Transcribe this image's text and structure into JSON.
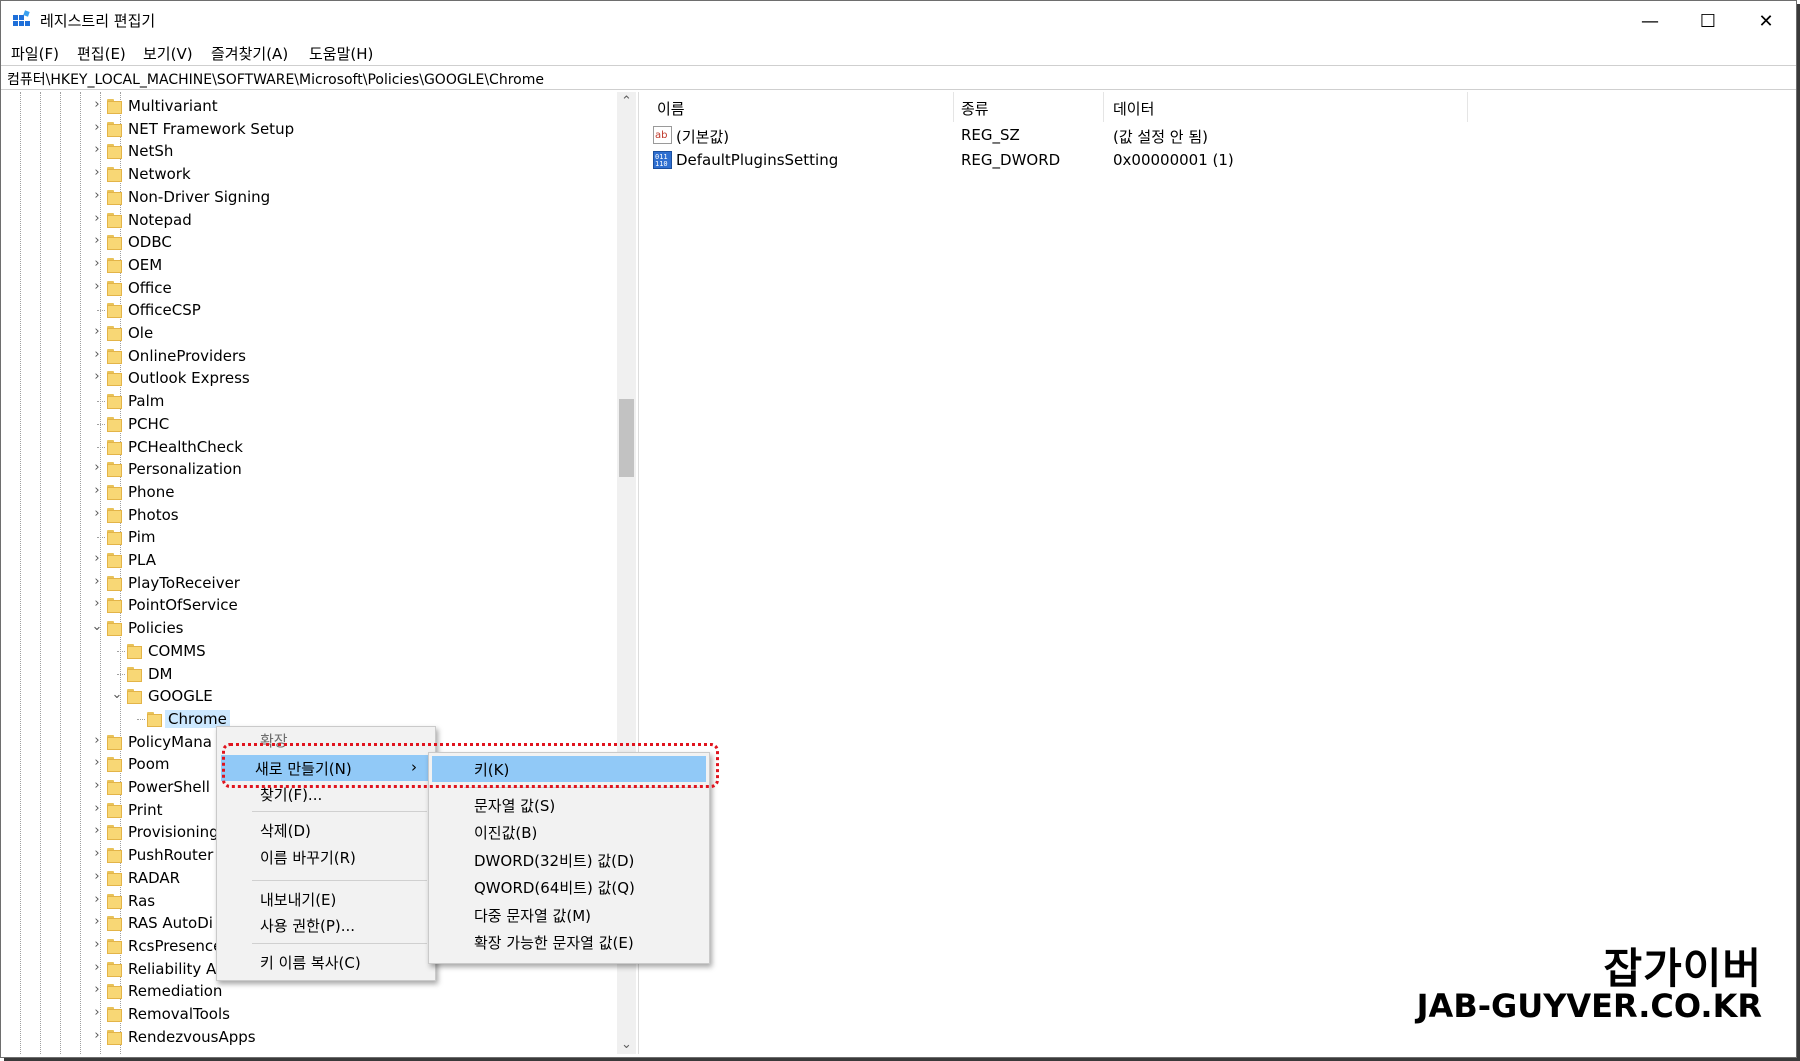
{
  "window": {
    "title": "레지스트리 편집기",
    "controls": {
      "minimize": "—",
      "maximize": "☐",
      "close": "✕"
    }
  },
  "menubar": [
    "파일(F)",
    "편집(E)",
    "보기(V)",
    "즐겨찾기(A)",
    "도움말(H)"
  ],
  "address": "컴퓨터\\HKEY_LOCAL_MACHINE\\SOFTWARE\\Microsoft\\Policies\\GOOGLE\\Chrome",
  "tree": [
    {
      "label": "Multivariant",
      "expander": "collapsed",
      "depth": 0
    },
    {
      "label": "NET Framework Setup",
      "expander": "collapsed",
      "depth": 0
    },
    {
      "label": "NetSh",
      "expander": "collapsed",
      "depth": 0
    },
    {
      "label": "Network",
      "expander": "collapsed",
      "depth": 0
    },
    {
      "label": "Non-Driver Signing",
      "expander": "collapsed",
      "depth": 0
    },
    {
      "label": "Notepad",
      "expander": "collapsed",
      "depth": 0
    },
    {
      "label": "ODBC",
      "expander": "collapsed",
      "depth": 0
    },
    {
      "label": "OEM",
      "expander": "collapsed",
      "depth": 0
    },
    {
      "label": "Office",
      "expander": "collapsed",
      "depth": 0
    },
    {
      "label": "OfficeCSP",
      "expander": "none",
      "depth": 0
    },
    {
      "label": "Ole",
      "expander": "collapsed",
      "depth": 0
    },
    {
      "label": "OnlineProviders",
      "expander": "collapsed",
      "depth": 0
    },
    {
      "label": "Outlook Express",
      "expander": "collapsed",
      "depth": 0
    },
    {
      "label": "Palm",
      "expander": "none",
      "depth": 0
    },
    {
      "label": "PCHC",
      "expander": "none",
      "depth": 0
    },
    {
      "label": "PCHealthCheck",
      "expander": "none",
      "depth": 0
    },
    {
      "label": "Personalization",
      "expander": "collapsed",
      "depth": 0
    },
    {
      "label": "Phone",
      "expander": "collapsed",
      "depth": 0
    },
    {
      "label": "Photos",
      "expander": "collapsed",
      "depth": 0
    },
    {
      "label": "Pim",
      "expander": "none",
      "depth": 0
    },
    {
      "label": "PLA",
      "expander": "collapsed",
      "depth": 0
    },
    {
      "label": "PlayToReceiver",
      "expander": "collapsed",
      "depth": 0
    },
    {
      "label": "PointOfService",
      "expander": "collapsed",
      "depth": 0
    },
    {
      "label": "Policies",
      "expander": "expanded",
      "depth": 0
    },
    {
      "label": "COMMS",
      "expander": "none",
      "depth": 1
    },
    {
      "label": "DM",
      "expander": "none",
      "depth": 1
    },
    {
      "label": "GOOGLE",
      "expander": "expanded",
      "depth": 1
    },
    {
      "label": "Chrome",
      "expander": "none",
      "depth": 2,
      "selected": true
    },
    {
      "label": "PolicyMana",
      "expander": "collapsed",
      "depth": 0
    },
    {
      "label": "Poom",
      "expander": "collapsed",
      "depth": 0
    },
    {
      "label": "PowerShell",
      "expander": "collapsed",
      "depth": 0
    },
    {
      "label": "Print",
      "expander": "collapsed",
      "depth": 0
    },
    {
      "label": "Provisioning",
      "expander": "collapsed",
      "depth": 0
    },
    {
      "label": "PushRouter",
      "expander": "collapsed",
      "depth": 0
    },
    {
      "label": "RADAR",
      "expander": "collapsed",
      "depth": 0
    },
    {
      "label": "Ras",
      "expander": "collapsed",
      "depth": 0
    },
    {
      "label": "RAS AutoDi",
      "expander": "collapsed",
      "depth": 0
    },
    {
      "label": "RcsPresence",
      "expander": "collapsed",
      "depth": 0
    },
    {
      "label": "Reliability A",
      "expander": "collapsed",
      "depth": 0
    },
    {
      "label": "Remediation",
      "expander": "collapsed",
      "depth": 0
    },
    {
      "label": "RemovalTools",
      "expander": "collapsed",
      "depth": 0
    },
    {
      "label": "RendezvousApps",
      "expander": "collapsed",
      "depth": 0
    }
  ],
  "list": {
    "columns": [
      "이름",
      "종류",
      "데이터"
    ],
    "rows": [
      {
        "icon": "string-value-icon",
        "name": "(기본값)",
        "type": "REG_SZ",
        "data": "(값 설정 안 됨)"
      },
      {
        "icon": "dword-value-icon",
        "name": "DefaultPluginsSetting",
        "type": "REG_DWORD",
        "data": "0x00000001 (1)"
      }
    ]
  },
  "context_menu": {
    "items": [
      "확장",
      "새로 만들기(N)",
      "찾기(F)...",
      "삭제(D)",
      "이름 바꾸기(R)",
      "내보내기(E)",
      "사용 권한(P)...",
      "키 이름 복사(C)"
    ],
    "highlighted": "새로 만들기(N)"
  },
  "submenu": {
    "items": [
      "키(K)",
      "문자열 값(S)",
      "이진값(B)",
      "DWORD(32비트) 값(D)",
      "QWORD(64비트) 값(Q)",
      "다중 문자열 값(M)",
      "확장 가능한 문자열 값(E)"
    ],
    "highlighted": "키(K)"
  },
  "watermark": {
    "korean": "잡가이버",
    "english": "JAB-GUYVER.CO.KR"
  },
  "colors": {
    "highlight": "#91c9f7",
    "selected": "#cce8ff",
    "annotation": "#e0141e",
    "folder": "#f8d775"
  }
}
